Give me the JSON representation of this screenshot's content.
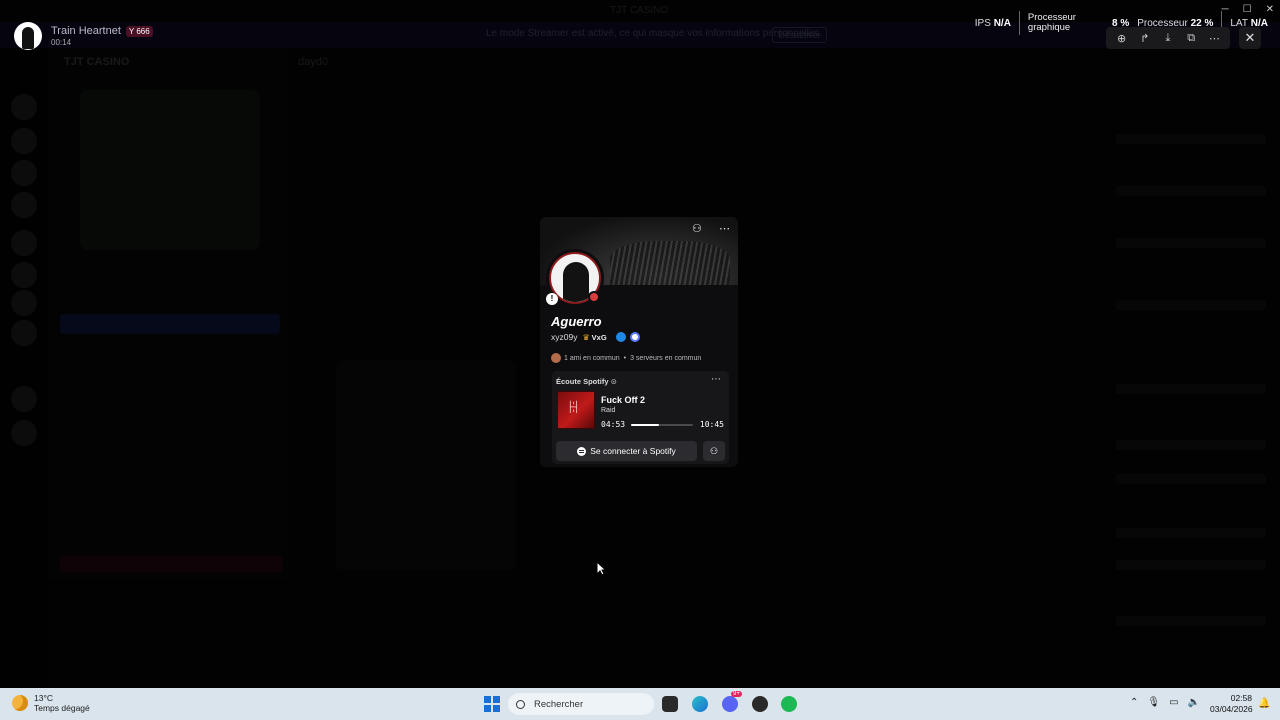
{
  "recording": {
    "title": "Train Heartnet",
    "badge": "666",
    "badge_icon": "heart-y-icon",
    "elapsed": "00:14"
  },
  "perf": {
    "ips_label": "IPS",
    "ips_value": "N/A",
    "gpu_label_1": "Processeur",
    "gpu_label_2": "graphique",
    "gpu_value": "8 %",
    "cpu_label": "Processeur",
    "cpu_value": "22 %",
    "lat_label": "LAT",
    "lat_value": "N/A"
  },
  "window_controls": [
    "minimize-icon",
    "maximize-icon",
    "close-icon"
  ],
  "overlay_toolbar": [
    "zoom-icon",
    "share-icon",
    "download-icon",
    "popout-icon",
    "more-icon"
  ],
  "background": {
    "window_title": "TJT CASINO",
    "banner_text": "Le mode Streamer est activé, ce qui masque vos informations personnelles.",
    "banner_button": "Désactiver",
    "guild_name": "TJT CASINO",
    "channel_name": "dayd0"
  },
  "profile": {
    "display_name": "Aguerro",
    "username": "xyz09y",
    "guild_tag": "VxG",
    "mutual_friends": "1 ami en commun",
    "mutual_servers": "3 serveurs en commun",
    "status": "dnd",
    "accent": "#8b1a1a"
  },
  "spotify": {
    "header": "Écoute Spotify",
    "track": "Fuck Off 2",
    "artist": "Raid",
    "elapsed": "04:53",
    "duration": "10:45",
    "progress": 0.455,
    "connect_label": "Se connecter à Spotify"
  },
  "taskbar": {
    "temperature": "13°C",
    "weather": "Temps dégagé",
    "search_placeholder": "Rechercher",
    "time": "02:58",
    "date": "03/04/2026",
    "discord_badge": "9+",
    "accent": "#1a6fd6"
  }
}
